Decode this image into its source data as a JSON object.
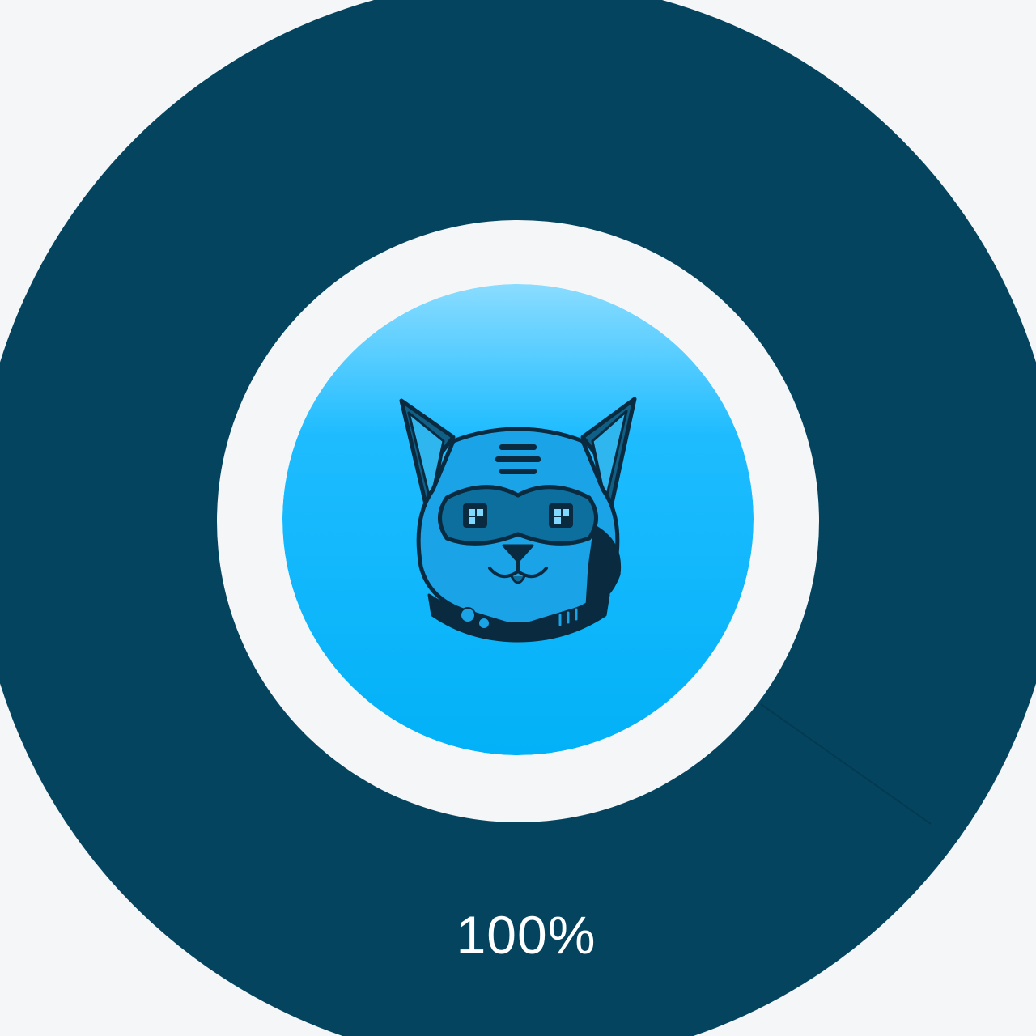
{
  "progress": {
    "value": 1.0,
    "label": "100%"
  },
  "colors": {
    "page_background": "#f5f6f7",
    "ring": "#04445f",
    "ring_seam": "#03374d",
    "inner_track": "#f5f6f7",
    "badge_top": "#7fd8ff",
    "badge_bottom": "#03b3f8",
    "mascot_line": "#0a2a3f",
    "mascot_fill": "#1aa3e6"
  },
  "icons": {
    "center": "cat-robot-mascot-icon"
  }
}
